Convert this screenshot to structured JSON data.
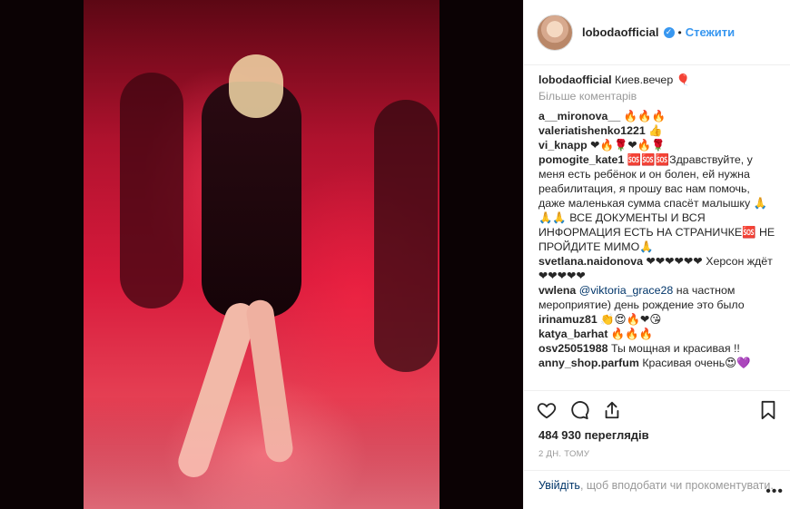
{
  "post": {
    "username": "lobodaofficial",
    "separator": "•",
    "follow_label": "Стежити",
    "caption_text": "Киев.вечер",
    "more_comments_label": "Більше коментарів",
    "views_label": "484 930 переглядів",
    "timestamp": "2 ДН. ТОМУ"
  },
  "comments": [
    {
      "user": "a__mironova__",
      "text": "🔥🔥🔥"
    },
    {
      "user": "valeriatishenko1221",
      "text": "👍"
    },
    {
      "user": "vi_knapp",
      "text": "❤🔥🌹❤🔥🌹"
    },
    {
      "user": "pomogite_kate1",
      "text": "🆘🆘🆘Здравствуйте, у меня есть ребёнок и он болен, ей нужна реабилитация, я прошу вас нам помочь, даже маленькая сумма спасёт малышку 🙏🙏🙏 ВСЕ ДОКУМЕНТЫ И ВСЯ ИНФОРМАЦИЯ ЕСТЬ НА СТРАНИЧКЕ🆘 НЕ ПРОЙДИТЕ МИМО🙏"
    },
    {
      "user": "svetlana.naidonova",
      "text": "❤❤❤❤❤❤ Херсон ждёт ❤❤❤❤❤"
    },
    {
      "user": "vwlena",
      "mention": "@viktoria_grace28",
      "text": " на частном мероприятие) день рождение это было"
    },
    {
      "user": "irinamuz81",
      "text": "👏😍🔥❤😘"
    },
    {
      "user": "katya_barhat",
      "text": "🔥🔥🔥"
    },
    {
      "user": "osv25051988",
      "text": "Ты мощная и красивая !!"
    },
    {
      "user": "anny_shop.parfum",
      "text": "Красивая очень😍💜"
    }
  ],
  "footer": {
    "login_label": "Увійдіть",
    "rest_text": ", щоб вподобати чи прокоментувати.",
    "more_dots": "•••"
  },
  "icons": {
    "like": "heart-icon",
    "comment": "comment-icon",
    "share": "share-icon",
    "save": "bookmark-icon"
  },
  "colors": {
    "accent": "#3897f0",
    "like_red": "#ed4956",
    "text": "#262626",
    "muted": "#999999"
  }
}
